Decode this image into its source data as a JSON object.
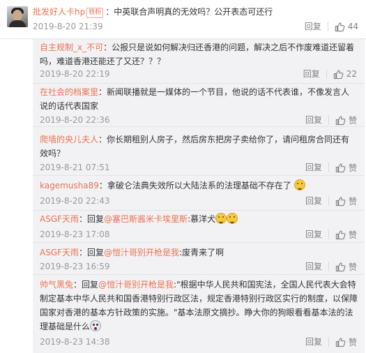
{
  "main_comment": {
    "user": "批发好人卡hp",
    "badge": "铁粉",
    "colon": "：",
    "text": "中英联合声明真的无效吗？公开表态可还行",
    "time": "2019-8-20 21:39",
    "reply_label": "回复",
    "like_count": "44"
  },
  "replies": [
    {
      "user": "自主规制_x_不可",
      "text": "：公报只是说如何解决归还香港的问题，解决之后不作废难道还留着吗，难道香港还能还了又还？？？",
      "time": "2019-8-20 22:19",
      "reply_label": "回复",
      "like": "22"
    },
    {
      "user": "在社会的档案里",
      "text": "：新闻联播就是一媒体的一个节目，他说的话不代表谁，不像发言人说的话代表国家",
      "time": "2019-8-20 22:36",
      "reply_label": "回复",
      "like": "赞"
    },
    {
      "user": "爬墙的央儿夫人",
      "text": "：你长期租别人房子，然后房东把房子卖给你了，请问租房合同还有效吗？",
      "time": "2019-8-21 07:51",
      "reply_label": "回复",
      "like": "赞"
    },
    {
      "user": "kagemusha89",
      "text": "：拿破仑法典失效所以大陆法系的法理基础不存在了",
      "time": "2019-8-20 22:43",
      "reply_label": "回复",
      "like": "赞"
    },
    {
      "user": "ASGF天雨",
      "prefix": "：回复",
      "mention": "@塞巴斯酱米卡埃里斯",
      "suffix": ":慕洋犬",
      "time": "2019-8-23 17:08",
      "reply_label": "回复",
      "like": "赞"
    },
    {
      "user": "ASGF天雨",
      "prefix": "：回复",
      "mention": "@愷汁哥别开枪是我",
      "suffix": ":废青来了啊",
      "time": "2019-8-23 16:59",
      "reply_label": "回复",
      "like": "赞"
    },
    {
      "user": "帅气黑兔",
      "prefix": "：回复",
      "mention": "@愷汁哥别开枪是我",
      "suffix": ":\"根据中华人民共和国宪法，全国人民代表大会特制定基本中华人民共和国香港特别行政区法，规定香港特别行政区实行的制度，以保障国家对香港的基本方针政策的实施。\"基本法原文摘抄。睁大你的狗眼看看基本法的法理基础是什么",
      "time": "2019-8-23 14:38",
      "reply_label": "回复",
      "like": "赞"
    }
  ],
  "colors": {
    "link": "#eb7350",
    "text": "#333333",
    "muted": "#999999",
    "reply_bg": "#f2f2f5"
  },
  "icons": [
    "thumbs-up-icon",
    "grin-emoji-icon",
    "shock-emoji-icon"
  ]
}
